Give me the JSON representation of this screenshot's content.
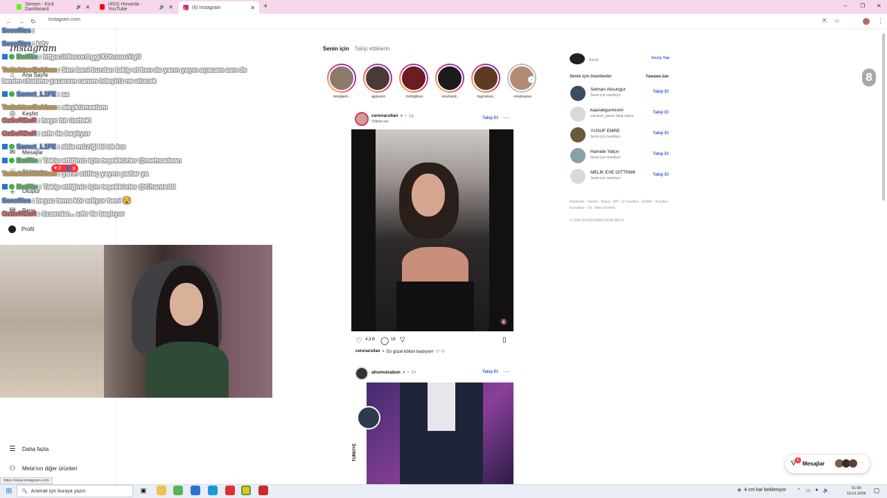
{
  "browser": {
    "tabs": [
      {
        "label": "Stream - Kick Dashboard"
      },
      {
        "label": "(453) Hovarda - YouTube"
      },
      {
        "label": "(6) Instagram"
      }
    ],
    "new_tab": "+",
    "url": "instagram.com",
    "status_url": "https://www.instagram.com",
    "window_controls": {
      "minimize": "─",
      "restore": "❐",
      "close": "✕"
    }
  },
  "instagram": {
    "logo": "Instagram",
    "sidebar": [
      {
        "label": "Ana Sayfa",
        "icon": "home-icon"
      },
      {
        "label": "Keşfet",
        "icon": "compass-icon"
      },
      {
        "label": "Mesajlar",
        "icon": "messenger-icon"
      },
      {
        "label": "Bildirimler",
        "icon": "heart-icon"
      },
      {
        "label": "Oluştur",
        "icon": "plus-icon"
      },
      {
        "label": "Pano",
        "icon": "dashboard-icon"
      },
      {
        "label": "Profil",
        "icon": "avatar"
      }
    ],
    "sidebar_bottom": [
      {
        "label": "Daha fazla",
        "icon": "menu-icon"
      },
      {
        "label": "Meta'nın diğer ürünleri",
        "icon": "meta-icon"
      }
    ],
    "notif_badges": {
      "likes": "2",
      "follows": "9"
    },
    "feed_tabs": {
      "for_you": "Senin için",
      "following": "Takip ettiklerin"
    },
    "stories": [
      {
        "name": "betulgenc...",
        "seen": false
      },
      {
        "name": "aguisenn",
        "seen": false
      },
      {
        "name": "mrrbigboss",
        "seen": false
      },
      {
        "name": "onurhand...",
        "seen": false
      },
      {
        "name": "tlugcekara...",
        "seen": false
      },
      {
        "name": "renaksassa",
        "seen": true
      }
    ],
    "post1": {
      "user": "cerenarsllan",
      "time": "1g",
      "audio": "Orijinal ses",
      "follow": "Takip Et",
      "likes": "4,3 B",
      "comments": "18",
      "caption_user": "cerenarsllan",
      "caption": "En güzel bölüm başlıyorrr 🤍🤍"
    },
    "post2": {
      "user": "aliumutzabun",
      "time": "1h",
      "follow": "Takip Et",
      "badge_text": "TÜRKİYE"
    },
    "right": {
      "account_sub": "Seval",
      "switch": "Geçiş Yap",
      "suggest_title": "Senin için önerilenler",
      "see_all": "Tümünü Gör",
      "suggestions": [
        {
          "name": "Selman Aksungur",
          "sub": "Senin için öneriliyor",
          "follow": "Takip Et"
        },
        {
          "name": "kaanakgunresmi",
          "sub": "sukranm_aacan takip ediyor",
          "follow": "Takip Et"
        },
        {
          "name": "YUSUF EMRE",
          "sub": "Senin için öneriliyor",
          "follow": "Takip Et"
        },
        {
          "name": "Hamide Yalçın",
          "sub": "Senin için öneriliyor",
          "follow": "Takip Et"
        },
        {
          "name": "MELİK EVE GİTTİNMİ",
          "sub": "Senin için öneriliyor",
          "follow": "Takip Et"
        }
      ],
      "footer_links": "Hakkında · Yardım · Basın · API · İş Fırsatları · Gizlilik · Koşullar · Konumlar · Dil · Meta Verified",
      "copyright": "© 2026 INSTAGRAM FROM META"
    },
    "messages_button": "Mesajlar",
    "messages_badge": "6"
  },
  "stream_counter": "8",
  "chat": [
    {
      "user": "Seeoflies",
      "msg": ": ",
      "color": "#2f6fd6"
    },
    {
      "user": "Seeoflies",
      "msg": ": kdv",
      "color": "#2f6fd6"
    },
    {
      "user": "BotRix",
      "msg": ": https://discord.gg/XDtcuuuVqU",
      "color": "#35b54a",
      "badges": true
    },
    {
      "user": "TwitchtenGokhan",
      "msg": ": Sen beni burdan takip et ben de yarın yayın açacam sen de",
      "color": "#d19a2a"
    },
    {
      "user": "",
      "msg": "benim chatime yazarsın canım ödeşiriz ne olucak",
      "color": "#ffffff"
    },
    {
      "user": "Samet_L1FE",
      "msg": ": sa",
      "color": "#2f6fd6",
      "badges": true
    },
    {
      "user": "TwitchtenGokhan",
      "msg": ": aleykümselam",
      "color": "#d19a2a"
    },
    {
      "user": "OzSeRDaR",
      "msg": ": hayır bir üstteki",
      "color": "#d63a3a"
    },
    {
      "user": "OzSeRDaR",
      "msg": ": sıfır ile başlıyor",
      "color": "#d63a3a"
    },
    {
      "user": "Samet_L1FE",
      "msg": ": abla müziği bi tık kıs",
      "color": "#2f6fd6",
      "badges": true
    },
    {
      "user": "BotRix",
      "msg": ": Takip ettiğiniz için teşekkürler @mehsadean",
      "color": "#35b54a",
      "badges": true
    },
    {
      "user": "TwitchtenGokhan",
      "msg": ": yarın sütlaç yayını patlar ya",
      "color": "#d19a2a"
    },
    {
      "user": "BotRix",
      "msg": ": Takip ettiğiniz için teşekkürler @Chantedd",
      "color": "#35b54a",
      "badges": true
    },
    {
      "user": "Seeoflies",
      "msg": ": beyaz tema kör ediyor beni 😵",
      "color": "#2f6fd6"
    },
    {
      "user": "OzSeRDaR",
      "msg": ": özserdar... sıfır ile başlıyor",
      "color": "#d63a3a"
    }
  ],
  "taskbar": {
    "search": "Aramak için buraya yazın",
    "weather": "4 cm kar bekleniyor",
    "time": "01:05",
    "date": "19.01.2026"
  }
}
